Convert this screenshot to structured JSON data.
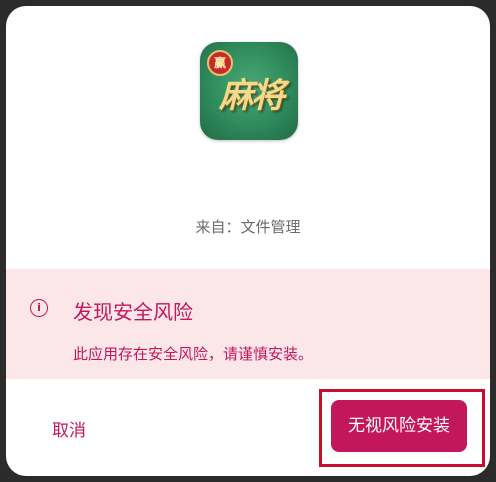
{
  "app": {
    "icon_name": "mahjong-app-icon",
    "icon_badge": "赢",
    "icon_text": "麻将"
  },
  "source_text": "来自：文件管理",
  "warning": {
    "icon_name": "info-circle-icon",
    "icon_glyph": "i",
    "title": "发现安全风险",
    "description": "此应用存在安全风险，请谨慎安装。"
  },
  "actions": {
    "cancel_label": "取消",
    "install_label": "无视风险安装"
  },
  "colors": {
    "accent": "#c2185b",
    "warning_bg": "#fbe6ea",
    "highlight_border": "#c8102e"
  }
}
